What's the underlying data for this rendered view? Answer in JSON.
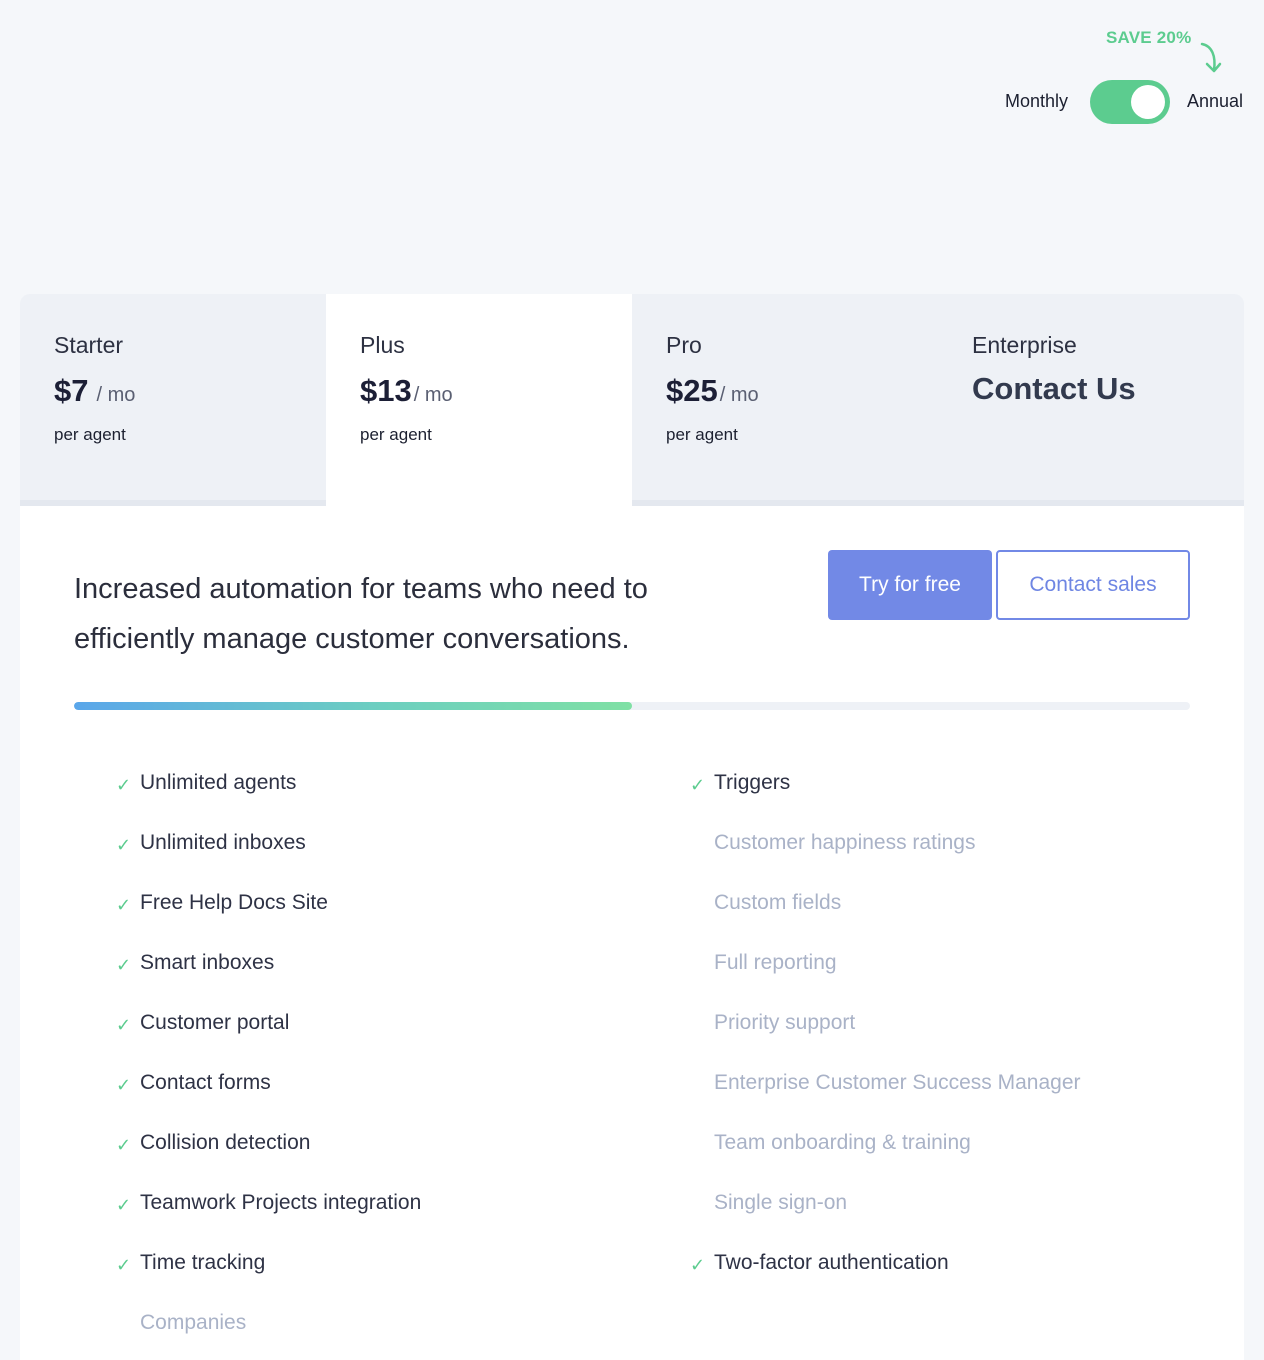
{
  "billing": {
    "save_badge": "SAVE 20%",
    "monthly_label": "Monthly",
    "annual_label": "Annual",
    "selected": "Annual",
    "accent": "#5ccc8f"
  },
  "plans": [
    {
      "name": "Starter",
      "price": "$7",
      "unit": "/ mo",
      "per": "per agent"
    },
    {
      "name": "Plus",
      "price": "$13",
      "unit": "/ mo",
      "per": "per agent"
    },
    {
      "name": "Pro",
      "price": "$25",
      "unit": "/ mo",
      "per": "per agent"
    },
    {
      "name": "Enterprise",
      "cta": "Contact Us"
    }
  ],
  "selected_plan": "Plus",
  "panel": {
    "description": "Increased automation for teams who need to efficiently manage customer conversations.",
    "try_button": "Try for free",
    "contact_button": "Contact sales",
    "tier_progress": 0.5,
    "primary_color": "#7289e6"
  },
  "features_left": [
    {
      "label": "Unlimited agents",
      "included": true
    },
    {
      "label": "Unlimited inboxes",
      "included": true
    },
    {
      "label": "Free Help Docs Site",
      "included": true
    },
    {
      "label": "Smart inboxes",
      "included": true
    },
    {
      "label": "Customer portal",
      "included": true
    },
    {
      "label": "Contact forms",
      "included": true
    },
    {
      "label": "Collision detection",
      "included": true
    },
    {
      "label": "Teamwork Projects integration",
      "included": true
    },
    {
      "label": "Time tracking",
      "included": true
    },
    {
      "label": "Companies",
      "included": false
    }
  ],
  "features_right": [
    {
      "label": "Triggers",
      "included": true
    },
    {
      "label": "Customer happiness ratings",
      "included": false
    },
    {
      "label": "Custom fields",
      "included": false
    },
    {
      "label": "Full reporting",
      "included": false
    },
    {
      "label": "Priority support",
      "included": false
    },
    {
      "label": "Enterprise Customer Success Manager",
      "included": false
    },
    {
      "label": "Team onboarding & training",
      "included": false
    },
    {
      "label": "Single sign-on",
      "included": false
    },
    {
      "label": "Two-factor authentication",
      "included": true
    }
  ],
  "check_glyph": "✓"
}
